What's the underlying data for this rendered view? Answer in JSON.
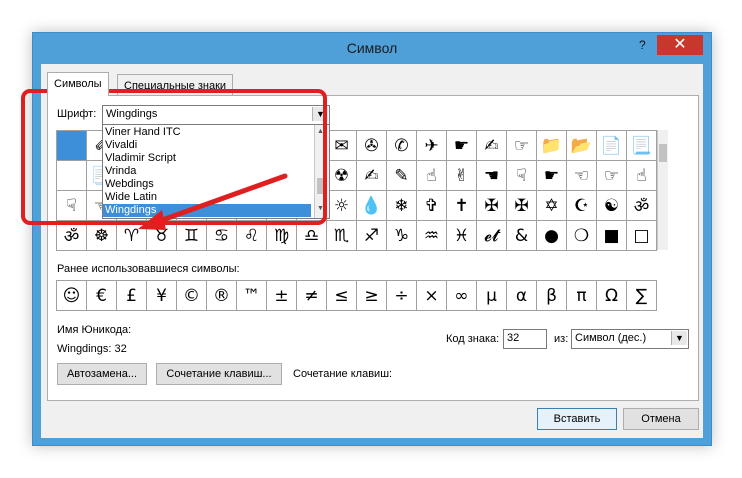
{
  "window": {
    "title": "Символ",
    "help": "?",
    "close": "✕"
  },
  "tabs": [
    {
      "label": "Символы"
    },
    {
      "label": "Специальные знаки"
    }
  ],
  "font": {
    "label": "Шрифт:",
    "value": "Wingdings"
  },
  "font_dropdown": {
    "items": [
      "Viner Hand ITC",
      "Vivaldi",
      "Vladimir Script",
      "Vrinda",
      "Webdings",
      "Wide Latin",
      "Wingdings"
    ],
    "selected": "Wingdings"
  },
  "grid_rows": [
    [
      "",
      "✐",
      "",
      "",
      "",
      "",
      "",
      "",
      "☻",
      "✉",
      "✇",
      "✆",
      "✈",
      "☛",
      "✍",
      "☞",
      "📁",
      "📂",
      "📄",
      "📃"
    ],
    [
      "",
      "📑",
      "",
      "",
      "",
      "",
      "",
      "",
      "⏻",
      "☢",
      "✍",
      "✎",
      "☝",
      "✌",
      "☚",
      "☟",
      "☛",
      "☜",
      "☞",
      "☝"
    ],
    [
      "☟",
      "☜",
      "",
      "",
      "",
      "",
      "",
      "",
      "✈",
      "☼",
      "💧",
      "❄",
      "✞",
      "✝",
      "✠",
      "✠",
      "✡",
      "☪",
      "☯",
      "ॐ"
    ],
    [
      "ॐ",
      "☸",
      "♈",
      "♉",
      "♊",
      "♋",
      "♌",
      "♍",
      "♎",
      "♏",
      "♐",
      "♑",
      "♒",
      "♓",
      "𝓮𝓽",
      "&",
      "●",
      "❍",
      "■",
      "□"
    ]
  ],
  "recent": {
    "label": "Ранее использовавшиеся символы:",
    "symbols": [
      "☺",
      "€",
      "£",
      "¥",
      "©",
      "®",
      "™",
      "±",
      "≠",
      "≤",
      "≥",
      "÷",
      "×",
      "∞",
      "µ",
      "α",
      "β",
      "π",
      "Ω",
      "∑"
    ]
  },
  "unicode": {
    "label": "Имя Юникода:",
    "value": "Wingdings: 32"
  },
  "char_code": {
    "label": "Код знака:",
    "value": "32"
  },
  "from": {
    "label": "из:",
    "value": "Символ (дес.)"
  },
  "autocorrect_btn": "Автозамена...",
  "shortcut_btn": "Сочетание клавиш...",
  "shortcut_label": "Сочетание клавиш:",
  "insert_btn": "Вставить",
  "cancel_btn": "Отмена",
  "colors": {
    "accent": "#3c8fd8",
    "annotation": "#e02020",
    "titlebar": "#4f9fd8",
    "close": "#c7372c"
  }
}
